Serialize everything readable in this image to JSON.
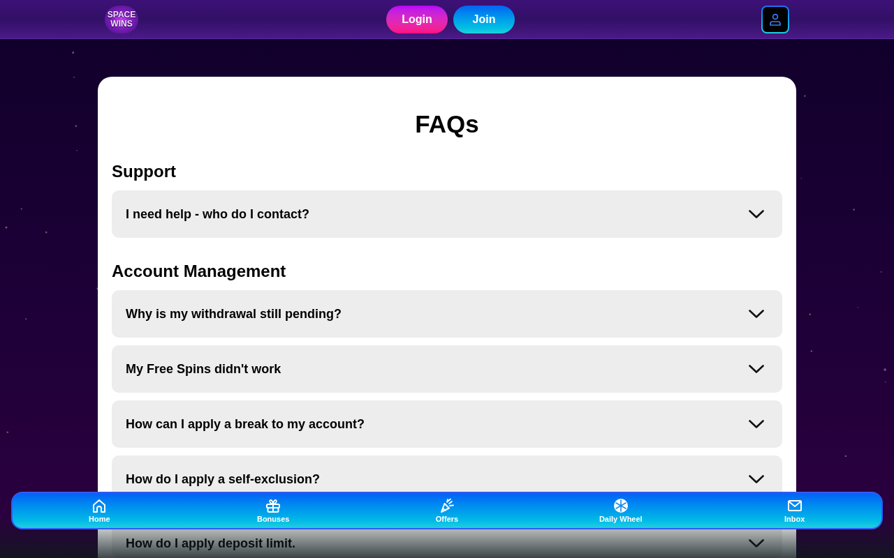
{
  "header": {
    "logo": "SPACE WINS",
    "buttons": [
      {
        "label": "Login",
        "kind": "login"
      },
      {
        "label": "Join",
        "kind": "join"
      }
    ]
  },
  "faq": {
    "title": "FAQs",
    "sections": [
      {
        "heading": "Support",
        "questions": [
          {
            "text": "I need help - who do I contact?",
            "expanded": false
          }
        ]
      },
      {
        "heading": "Account Management",
        "questions": [
          {
            "text": "Why is my withdrawal still pending?",
            "expanded": false
          },
          {
            "text": "My Free Spins didn't work",
            "expanded": false
          },
          {
            "text": "How can I apply a break to my account?",
            "expanded": false
          },
          {
            "text": "How do I apply a self-exclusion?",
            "expanded": false
          },
          {
            "text": "How do I apply deposit limit.",
            "expanded": false
          }
        ]
      }
    ]
  },
  "bottom_nav": {
    "items": [
      {
        "label": "Home"
      },
      {
        "label": "Bonuses"
      },
      {
        "label": "Offers"
      },
      {
        "label": "Daily Wheel"
      },
      {
        "label": "Inbox"
      }
    ]
  }
}
